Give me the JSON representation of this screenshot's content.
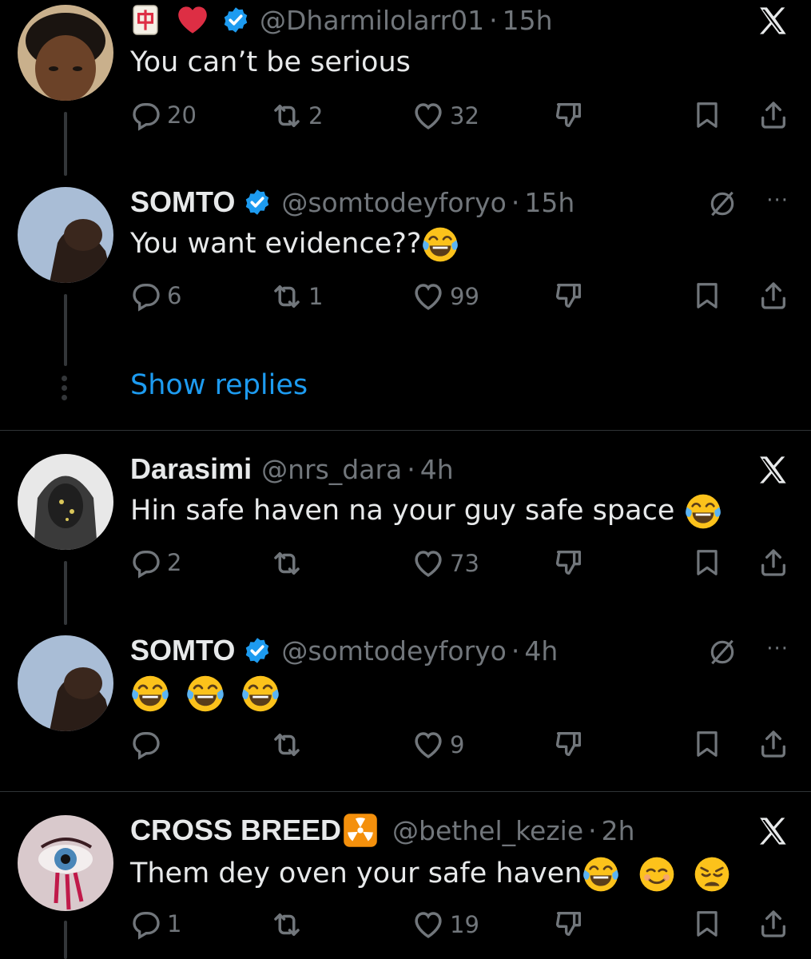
{
  "tweets": [
    {
      "prefix_emojis": [
        "mahjong-tile-icon",
        "red-heart-icon"
      ],
      "name": "",
      "verified": true,
      "handle": "@Dharmilolarr01",
      "time": "15h",
      "text": "You can’t be serious",
      "replies": "20",
      "reposts": "2",
      "likes": "32"
    },
    {
      "name": "SOMTO",
      "verified": true,
      "handle": "@somtodeyforyo",
      "time": "15h",
      "text": "You want evidence??",
      "replies": "6",
      "reposts": "1",
      "likes": "99"
    },
    {
      "name": "Darasimi",
      "verified": false,
      "handle": "@nrs_dara",
      "time": "4h",
      "text": "Hin safe haven na your guy safe space",
      "replies": "2",
      "reposts": "",
      "likes": "73"
    },
    {
      "name": "SOMTO",
      "verified": true,
      "handle": "@somtodeyforyo",
      "time": "4h",
      "text": "",
      "replies": "",
      "reposts": "",
      "likes": "9"
    },
    {
      "name": "CROSS BREED",
      "verified": false,
      "handle": "@bethel_kezie",
      "time": "2h",
      "text": "Them dey oven your safe haven",
      "replies": "1",
      "reposts": "",
      "likes": "19"
    }
  ],
  "show_replies_label": "Show replies",
  "separator": "·",
  "more_label": "···",
  "colors": {
    "background": "#000000",
    "text": "#e7e9ea",
    "muted": "#71767b",
    "link": "#1d9bf0",
    "verified": "#1d9bf0"
  }
}
